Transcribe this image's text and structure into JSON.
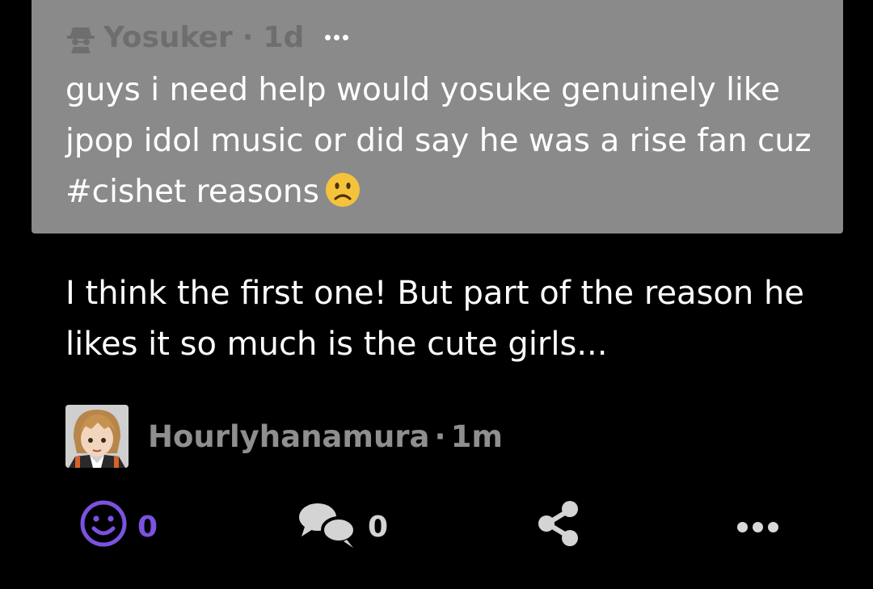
{
  "quoted_post": {
    "username": "Yosuker",
    "separator": "·",
    "time": "1d",
    "text": "guys i need help would yosuke genuinely like jpop idol music or did say he was a rise fan cuz #cishet reasons",
    "emoji_icon": "slightly-frowning-face-icon",
    "user_icon": "spy-icon"
  },
  "reply": {
    "text": "I think the first one! But part of the reason he likes it so much is the cute girls..."
  },
  "author": {
    "username": "Hourlyhanamura",
    "separator": "·",
    "time": "1m"
  },
  "actions": {
    "reactions_count": "0",
    "comments_count": "0",
    "react_icon": "smiley-icon",
    "comment_icon": "speech-bubbles-icon",
    "share_icon": "share-icon",
    "more_icon": "more-horizontal-icon"
  },
  "colors": {
    "background": "#000000",
    "quote_background": "#8a8a8a",
    "accent": "#7b52e0"
  }
}
